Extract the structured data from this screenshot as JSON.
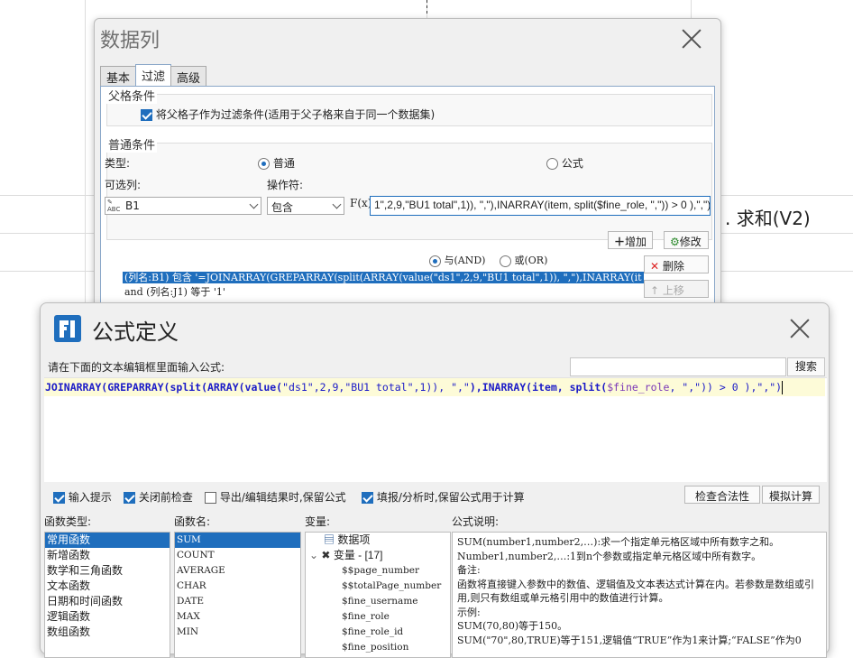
{
  "sheet": {
    "cell_text": ". 求和(V2)"
  },
  "data_column_dialog": {
    "title": "数据列",
    "tabs": [
      {
        "label": "基本"
      },
      {
        "label": "过滤"
      },
      {
        "label": "高级"
      }
    ],
    "parent_group": {
      "label": "父格条件",
      "checkbox_label": "将父格子作为过滤条件(适用于父子格来自于同一个数据集)"
    },
    "normal_group": {
      "label": "普通条件",
      "type_label": "类型:",
      "type_normal": "普通",
      "type_formula": "公式",
      "column_label": "可选列:",
      "operator_label": "操作符:",
      "column_value": "B1",
      "operator_value": "包含",
      "fx_label": "F(x)",
      "formula_value": "1\",2,9,\"BU1 total\",1)), \",\"),INARRAY(item, split($fine_role, \",\")) > 0 ),\",\")"
    },
    "logic_and": "与(AND)",
    "logic_or": "或(OR)",
    "buttons": {
      "add": "增加",
      "modify": "修改",
      "delete": "删除",
      "move_up": "上移"
    },
    "conditions": [
      "(列名:B1) 包含 '=JOINARRAY(GREPARRAY(split(ARRAY(value(\"ds1\",2,9,\"BU1 total\",1)), \",\"),INARRAY(it",
      "and (列名:J1) 等于 '1'"
    ]
  },
  "formula_dialog": {
    "title": "公式定义",
    "hint": "请在下面的文本编辑框里面输入公式:",
    "search_button": "搜索",
    "formula": {
      "p1": "JOINARRAY(GREPARRAY(split(ARRAY(value(",
      "p2": "\"ds1\"",
      "p3": ",2,9,",
      "p4": "\"BU1 total\"",
      "p5": ",1)), ",
      "p6": "\",\"",
      "p7": "),INARRAY(item, split(",
      "p8": "$fine_role",
      "p9": ", ",
      "p10": "\",\"",
      "p11": ")) > 0 ),",
      "p12": "\",\"",
      "p13": ")"
    },
    "options": {
      "input_hint": "输入提示",
      "check_before_close": "关闭前检查",
      "keep_formula_export": "导出/编辑结果时,保留公式",
      "keep_formula_fill": "填报/分析时,保留公式用于计算",
      "validate_button": "检查合法性",
      "simulate_button": "模拟计算"
    },
    "function_type_label": "函数类型:",
    "function_types": [
      "常用函数",
      "新增函数",
      "数学和三角函数",
      "文本函数",
      "日期和时间函数",
      "逻辑函数",
      "数组函数"
    ],
    "function_name_label": "函数名:",
    "function_names": [
      "SUM",
      "COUNT",
      "AVERAGE",
      "CHAR",
      "DATE",
      "MAX",
      "MIN"
    ],
    "variable_label": "变量:",
    "variables": {
      "data_item": "数据项",
      "var_group": "变量 - [17]",
      "items": [
        "$$page_number",
        "$$totalPage_number",
        "$fine_username",
        "$fine_role",
        "$fine_role_id",
        "$fine_position"
      ]
    },
    "description_label": "公式说明:",
    "description_lines": [
      "SUM(number1,number2,…):求一个指定单元格区域中所有数字之和。",
      "Number1,number2,…:1到n个参数或指定单元格区域中所有数字。",
      "备注:",
      "函数将直接键入参数中的数值、逻辑值及文本表达式计算在内。若参数是数组或引用,则只有数组或单元格引用中的数值进行计算。",
      "示例:",
      "SUM(70,80)等于150。",
      "SUM(\"70\",80,TRUE)等于151,逻辑值“TRUE”作为1来计算;“FALSE”作为0"
    ]
  }
}
